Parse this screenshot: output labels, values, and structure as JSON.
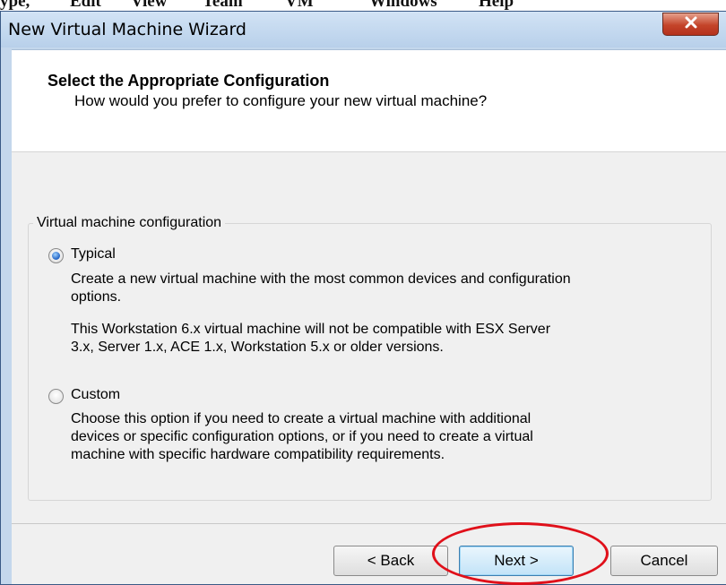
{
  "host_menu": {
    "items": [
      "ype,",
      "Edit",
      "View",
      "Team",
      "VM",
      "Windows",
      "Help"
    ]
  },
  "window": {
    "title": "New Virtual Machine Wizard"
  },
  "header": {
    "title": "Select the Appropriate Configuration",
    "subtitle": "How would you prefer to configure your new virtual machine?"
  },
  "config_group": {
    "legend": "Virtual machine configuration",
    "options": [
      {
        "label": "Typical",
        "selected": true,
        "description": [
          "Create a new virtual machine with the most common devices and configuration",
          "options."
        ],
        "note": [
          "This Workstation 6.x virtual machine will not be compatible with ESX Server",
          "3.x, Server 1.x, ACE 1.x, Workstation 5.x or older versions."
        ]
      },
      {
        "label": "Custom",
        "selected": false,
        "description": [
          "Choose this option if you need to create a virtual machine with additional",
          "devices or specific configuration options, or if you need to create a virtual",
          "machine with specific hardware compatibility requirements."
        ]
      }
    ]
  },
  "buttons": {
    "back": "< Back",
    "next": "Next >",
    "cancel": "Cancel"
  },
  "annotation": {
    "color": "#e0101a"
  }
}
